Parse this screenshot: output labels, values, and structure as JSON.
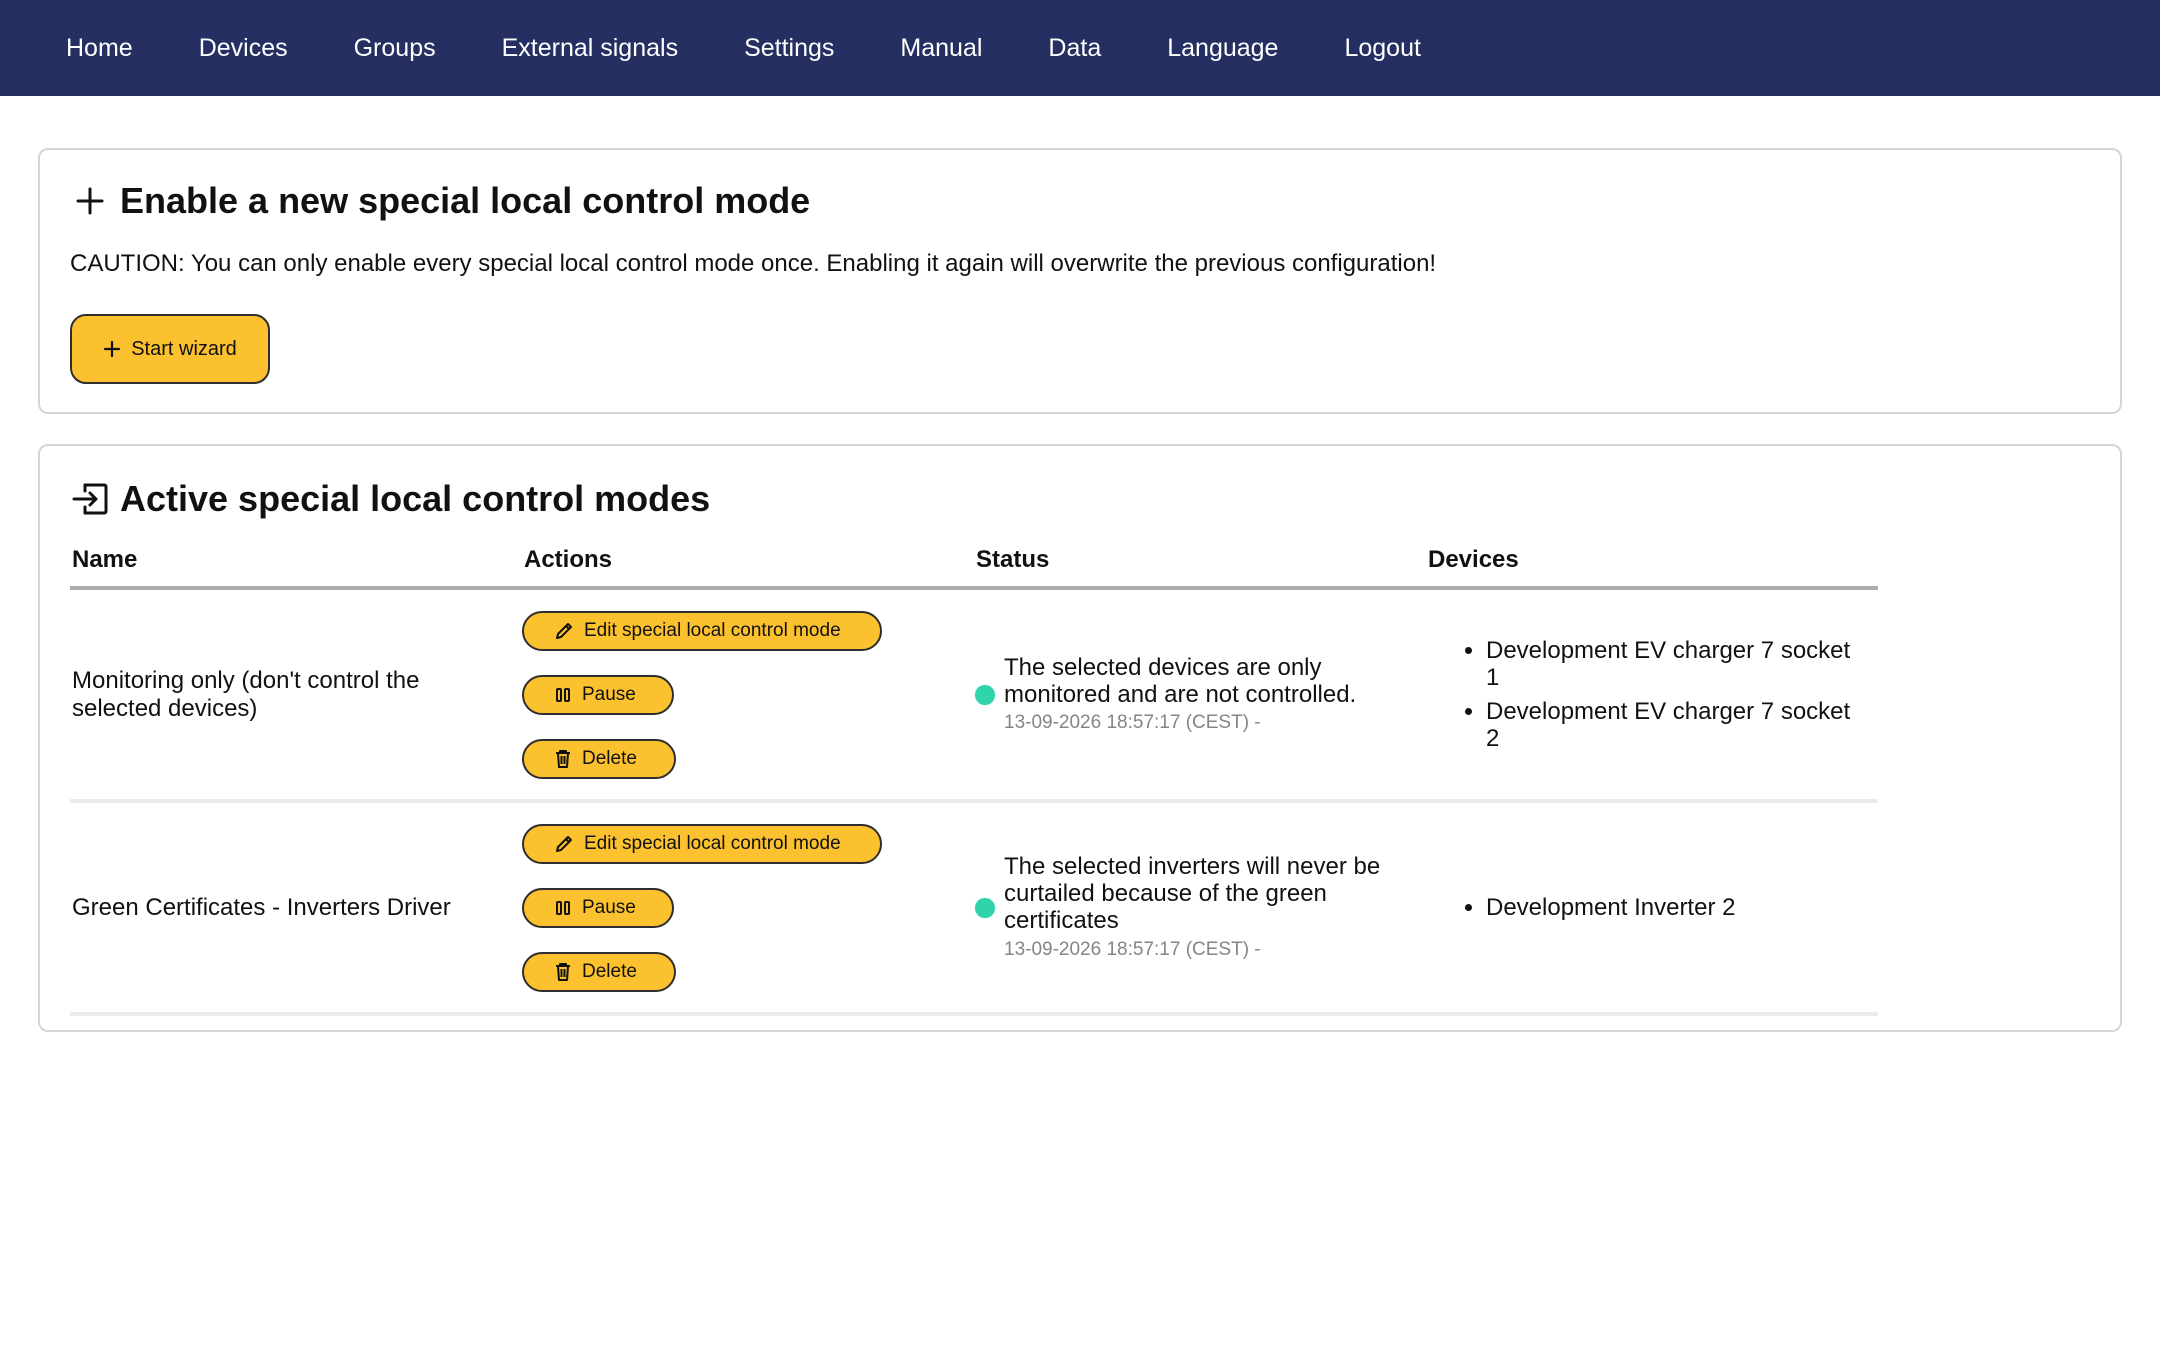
{
  "nav": {
    "items": [
      {
        "id": "home",
        "label": "Home"
      },
      {
        "id": "devices",
        "label": "Devices"
      },
      {
        "id": "groups",
        "label": "Groups"
      },
      {
        "id": "external-signals",
        "label": "External signals"
      },
      {
        "id": "settings",
        "label": "Settings"
      },
      {
        "id": "manual",
        "label": "Manual"
      },
      {
        "id": "data",
        "label": "Data"
      },
      {
        "id": "language",
        "label": "Language"
      },
      {
        "id": "logout",
        "label": "Logout"
      }
    ]
  },
  "enable_section": {
    "icon": "plus-icon",
    "title": "Enable a new special local control mode",
    "caution": "CAUTION: You can only enable every special local control mode once. Enabling it again will overwrite the previous configuration!",
    "button_label": "Start wizard"
  },
  "active_section": {
    "icon": "enter-box-icon",
    "title": "Active special local control modes",
    "columns": [
      "Name",
      "Actions",
      "Status",
      "Devices"
    ],
    "rows": [
      {
        "name": "Monitoring only (don't control the selected devices)",
        "actions": {
          "edit": "Edit special local control mode",
          "pause": "Pause",
          "delete": "Delete"
        },
        "status_text": "The selected devices are only monitored and are not controlled.",
        "status_time": "13-09-2026 18:57:17 (CEST) -",
        "devices": [
          "Development EV charger 7 socket 1",
          "Development EV charger 7 socket 2"
        ]
      },
      {
        "name": "Green Certificates - Inverters Driver",
        "actions": {
          "edit": "Edit special local control mode",
          "pause": "Pause",
          "delete": "Delete"
        },
        "status_text": "The selected inverters will never be curtailed because of the green certificates",
        "status_time": "13-09-2026 18:57:17 (CEST) -",
        "devices": [
          "Development Inverter 2"
        ]
      }
    ]
  },
  "colors": {
    "nav_bg": "#252f62",
    "accent": "#fcc12e",
    "status_ok": "#2fd3ac"
  }
}
